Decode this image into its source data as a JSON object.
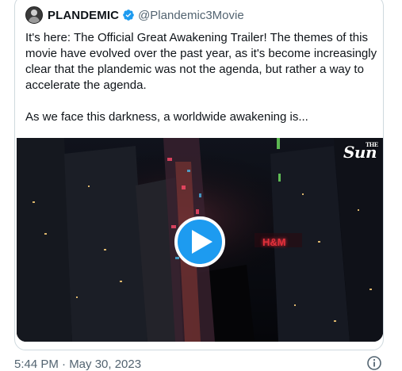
{
  "tweet": {
    "author_name": "PLANDEMIC",
    "handle": "@Plandemic3Movie",
    "paragraph1": "It's here: The Official Great Awakening Trailer! The themes of this movie have evolved over the past year, as it's become increasingly clear that the plandemic was not the agenda, but rather a way to accelerate the agenda.",
    "paragraph2": "As we face this darkness, a worldwide awakening is...",
    "timestamp": "5:44 PM · May 30, 2023"
  },
  "media": {
    "watermark_small": "THE",
    "watermark": "Sun",
    "sign_text": "H&M",
    "play_icon": "play-icon"
  },
  "icons": {
    "verified": "verified-badge-icon",
    "info": "info-icon"
  },
  "colors": {
    "accent": "#1d9bf0",
    "secondary_text": "#536471",
    "border": "#cfd9de"
  }
}
